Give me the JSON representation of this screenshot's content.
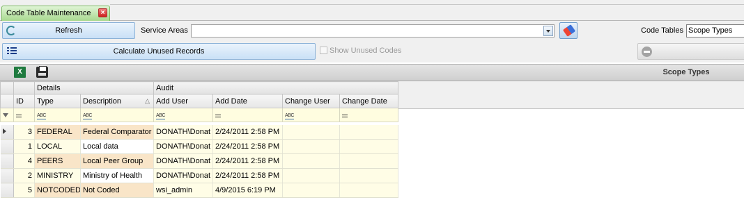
{
  "tab": {
    "title": "Code Table Maintenance",
    "close_icon": "close-icon"
  },
  "toolbar": {
    "refresh_label": "Refresh",
    "calculate_label": "Calculate Unused Records",
    "service_areas_label": "Service Areas",
    "service_areas_value": "",
    "code_tables_label": "Code Tables",
    "code_tables_value": "Scope Types",
    "show_unused_label": "Show Unused Codes"
  },
  "grid": {
    "title": "Scope Types",
    "bands": {
      "details": "Details",
      "audit": "Audit"
    },
    "columns": [
      "ID",
      "Type",
      "Description",
      "Add User",
      "Add Date",
      "Change User",
      "Change Date"
    ],
    "rows": [
      {
        "id": "3",
        "type": "FEDERAL",
        "description": "Federal Comparator",
        "add_user": "DONATH\\Donat",
        "add_date": "2/24/2011 2:58 PM",
        "change_user": "",
        "change_date": ""
      },
      {
        "id": "1",
        "type": "LOCAL",
        "description": "Local data",
        "add_user": "DONATH\\Donat",
        "add_date": "2/24/2011 2:58 PM",
        "change_user": "",
        "change_date": ""
      },
      {
        "id": "4",
        "type": "PEERS",
        "description": "Local Peer Group",
        "add_user": "DONATH\\Donat",
        "add_date": "2/24/2011 2:58 PM",
        "change_user": "",
        "change_date": ""
      },
      {
        "id": "2",
        "type": "MINISTRY",
        "description": "Ministry of Health",
        "add_user": "DONATH\\Donat",
        "add_date": "2/24/2011 2:58 PM",
        "change_user": "",
        "change_date": ""
      },
      {
        "id": "5",
        "type": "NOTCODED",
        "description": "Not Coded",
        "add_user": "wsi_admin",
        "add_date": "4/9/2015 6:19 PM",
        "change_user": "",
        "change_date": ""
      }
    ]
  }
}
